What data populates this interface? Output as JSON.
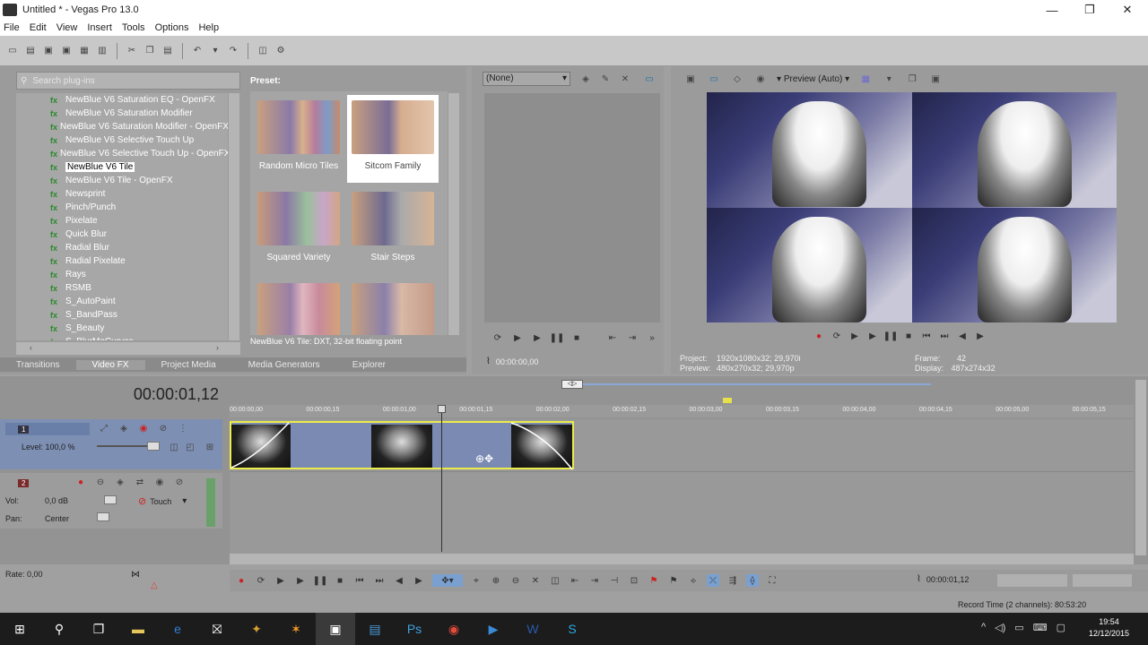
{
  "window": {
    "title": "Untitled * - Vegas Pro 13.0"
  },
  "menu": [
    "File",
    "Edit",
    "View",
    "Insert",
    "Tools",
    "Options",
    "Help"
  ],
  "plugins": {
    "search_placeholder": "Search plug-ins",
    "items": [
      "NewBlue V6 Saturation EQ - OpenFX",
      "NewBlue V6 Saturation Modifier",
      "NewBlue V6 Saturation Modifier - OpenFX",
      "NewBlue V6 Selective Touch Up",
      "NewBlue V6 Selective Touch Up - OpenFX",
      "NewBlue V6 Tile",
      "NewBlue V6 Tile - OpenFX",
      "Newsprint",
      "Pinch/Punch",
      "Pixelate",
      "Quick Blur",
      "Radial Blur",
      "Radial Pixelate",
      "Rays",
      "RSMB",
      "S_AutoPaint",
      "S_BandPass",
      "S_Beauty",
      "S_BlurMoCurves"
    ],
    "selected_index": 5
  },
  "presets": {
    "label": "Preset:",
    "items": [
      "Random Micro Tiles",
      "Sitcom Family",
      "Squared Variety",
      "Stair Steps",
      "",
      ""
    ],
    "status": "NewBlue V6 Tile: DXT, 32-bit floating point"
  },
  "bottom_tabs": [
    "Transitions",
    "Video FX",
    "Project Media",
    "Media Generators",
    "Explorer"
  ],
  "trimmer": {
    "dropdown": "(None)",
    "timecode": "00:00:00,00"
  },
  "preview": {
    "mode": "Preview (Auto)",
    "project_label": "Project:",
    "project": "1920x1080x32; 29,970i",
    "preview_label": "Preview:",
    "preview_value": "480x270x32; 29,970p",
    "frame_label": "Frame:",
    "frame": "42",
    "display_label": "Display:",
    "display": "487x274x32"
  },
  "timeline": {
    "current_time": "00:00:01,12",
    "ruler": [
      "00:00:00,00",
      "00:00:00,15",
      "00:00:01,00",
      "00:00:01,15",
      "00:00:02,00",
      "00:00:02,15",
      "00:00:03,00",
      "00:00:03,15",
      "00:00:04,00",
      "00:00:04,15",
      "00:00:05,00",
      "00:00:05,15"
    ],
    "video_track": {
      "number": "1",
      "level": "Level: 100,0 %"
    },
    "audio_track": {
      "number": "2",
      "vol_label": "Vol:",
      "vol": "0,0 dB",
      "pan_label": "Pan:",
      "pan": "Center",
      "touch": "Touch"
    },
    "rate": "Rate: 0,00",
    "cursor_time": "00:00:01,12",
    "record_time": "Record Time (2 channels): 80:53:20"
  },
  "taskbar": {
    "time": "19:54",
    "date": "12/12/2015"
  }
}
